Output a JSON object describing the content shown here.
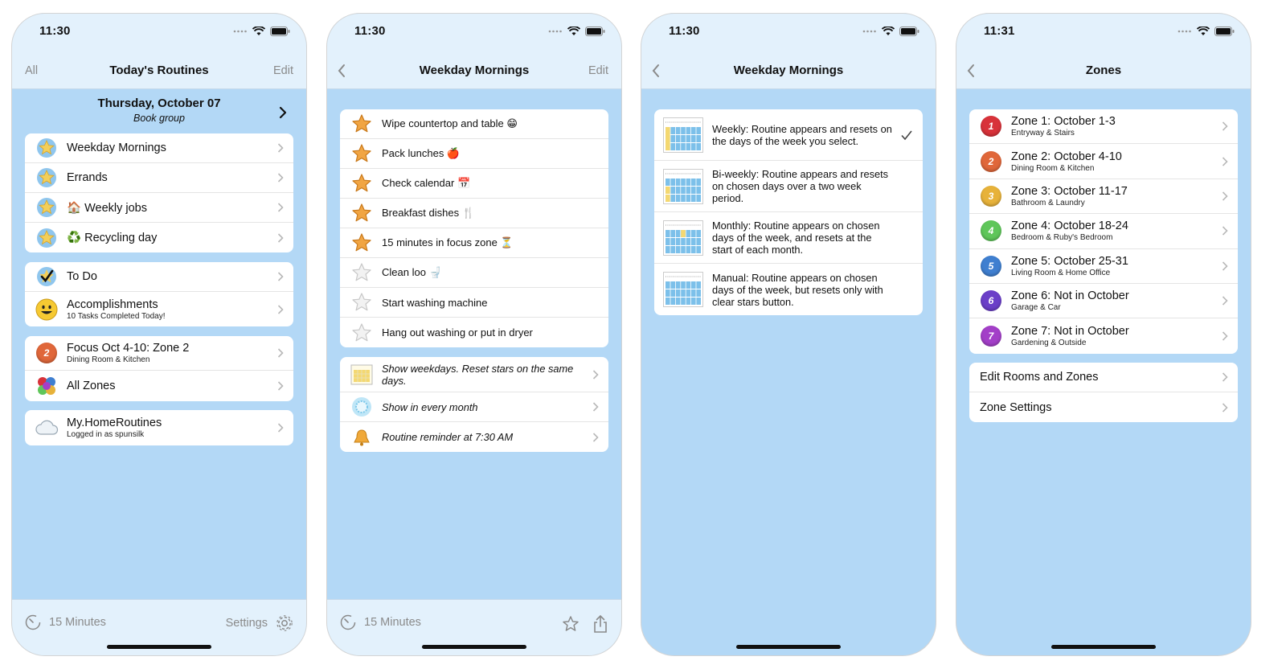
{
  "screens": [
    {
      "status_time": "11:30",
      "nav": {
        "left": "All",
        "title": "Today's Routines",
        "right": "Edit"
      },
      "date": {
        "main": "Thursday, October 07",
        "sub": "Book group"
      },
      "routines": [
        {
          "label": "Weekday Mornings"
        },
        {
          "label": "Errands"
        },
        {
          "emoji": "🏠",
          "label": "Weekly jobs"
        },
        {
          "emoji": "♻️",
          "label": "Recycling day"
        }
      ],
      "todo": {
        "label": "To Do"
      },
      "accomplishments": {
        "label": "Accomplishments",
        "sub": "10 Tasks Completed Today!"
      },
      "focus": {
        "label": "Focus Oct 4-10: Zone 2",
        "sub": "Dining Room & Kitchen",
        "badge": "2"
      },
      "all_zones": {
        "label": "All Zones"
      },
      "account": {
        "label": "My.HomeRoutines",
        "sub": "Logged in as spunsilk"
      },
      "toolbar": {
        "timer": "15 Minutes",
        "settings": "Settings"
      }
    },
    {
      "status_time": "11:30",
      "nav": {
        "title": "Weekday Mornings",
        "right": "Edit"
      },
      "tasks": [
        {
          "label": "Wipe countertop and table 😁",
          "starred": true
        },
        {
          "label": "Pack lunches 🍎",
          "starred": true
        },
        {
          "label": "Check calendar 📅",
          "starred": true
        },
        {
          "label": "Breakfast dishes 🍴",
          "starred": true
        },
        {
          "label": "15 minutes in focus zone ⏳",
          "starred": true
        },
        {
          "label": "Clean loo 🚽",
          "starred": false
        },
        {
          "label": "Start washing machine",
          "starred": false
        },
        {
          "label": "Hang out washing or put in dryer",
          "starred": false
        }
      ],
      "options": [
        {
          "label": "Show weekdays. Reset stars on the same days."
        },
        {
          "label": "Show in every month"
        },
        {
          "label": "Routine reminder at 7:30 AM"
        }
      ],
      "toolbar": {
        "timer": "15 Minutes"
      }
    },
    {
      "status_time": "11:30",
      "nav": {
        "title": "Weekday Mornings"
      },
      "modes": [
        {
          "label": "Weekly: Routine appears and resets on the days of the week you select.",
          "selected": true
        },
        {
          "label": "Bi-weekly: Routine appears and resets on chosen days over a two week period.",
          "selected": false
        },
        {
          "label": "Monthly: Routine appears on chosen days of the week, and resets at the start of each month.",
          "selected": false
        },
        {
          "label": "Manual: Routine appears on chosen days of the week, but resets only with clear stars button.",
          "selected": false
        }
      ]
    },
    {
      "status_time": "11:31",
      "nav": {
        "title": "Zones"
      },
      "zones": [
        {
          "num": "1",
          "label": "Zone 1: October 1-3",
          "sub": "Entryway & Stairs",
          "color": "#d8323a"
        },
        {
          "num": "2",
          "label": "Zone 2: October 4-10",
          "sub": "Dining Room & Kitchen",
          "color": "#e0673a"
        },
        {
          "num": "3",
          "label": "Zone 3: October 11-17",
          "sub": "Bathroom & Laundry",
          "color": "#e7b23a"
        },
        {
          "num": "4",
          "label": "Zone 4: October 18-24",
          "sub": "Bedroom & Ruby's Bedroom",
          "color": "#5fc65a"
        },
        {
          "num": "5",
          "label": "Zone 5: October 25-31",
          "sub": "Living Room & Home Office",
          "color": "#3f7fd0"
        },
        {
          "num": "6",
          "label": "Zone 6: Not in October",
          "sub": "Garage & Car",
          "color": "#6b3fc8"
        },
        {
          "num": "7",
          "label": "Zone 7: Not in October",
          "sub": "Gardening & Outside",
          "color": "#a33fc8"
        }
      ],
      "settings": [
        {
          "label": "Edit Rooms and Zones"
        },
        {
          "label": "Zone Settings"
        }
      ]
    }
  ]
}
